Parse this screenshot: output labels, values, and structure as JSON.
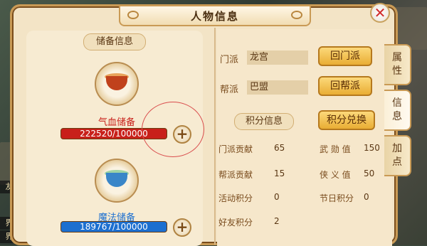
{
  "window": {
    "title": "人物信息"
  },
  "background": {
    "chat_lines": [
      "友",
      "界",
      "界"
    ]
  },
  "storage": {
    "section_label": "储备信息",
    "hp": {
      "label": "气血储备",
      "value_text": "222520/100000",
      "fill_fraction": 1.0,
      "color": "#c8201a"
    },
    "mp": {
      "label": "魔法储备",
      "value_text": "189767/100000",
      "fill_fraction": 1.0,
      "color": "#1c6fd0"
    }
  },
  "sect": {
    "label": "门派",
    "value": "龙宫",
    "button": "回门派"
  },
  "guild": {
    "label": "帮派",
    "value": "巴盟",
    "button": "回帮派"
  },
  "points": {
    "section_label": "积分信息",
    "exchange_button": "积分兑换",
    "stats": [
      {
        "label": "门派贡献",
        "value": "65"
      },
      {
        "label": "武 勋 值",
        "value": "150"
      },
      {
        "label": "帮派贡献",
        "value": "15"
      },
      {
        "label": "侠 义 值",
        "value": "50"
      },
      {
        "label": "活动积分",
        "value": "0"
      },
      {
        "label": "节日积分",
        "value": "0"
      },
      {
        "label": "好友积分",
        "value": "2"
      }
    ]
  },
  "tabs": [
    {
      "label": "属\n性",
      "active": false
    },
    {
      "label": "信\n息",
      "active": true
    },
    {
      "label": "加\n点",
      "active": false
    }
  ],
  "colors": {
    "accent_gold": "#e9ad34",
    "highlight_circle": "#d94d4d",
    "close_x": "#d12929"
  }
}
